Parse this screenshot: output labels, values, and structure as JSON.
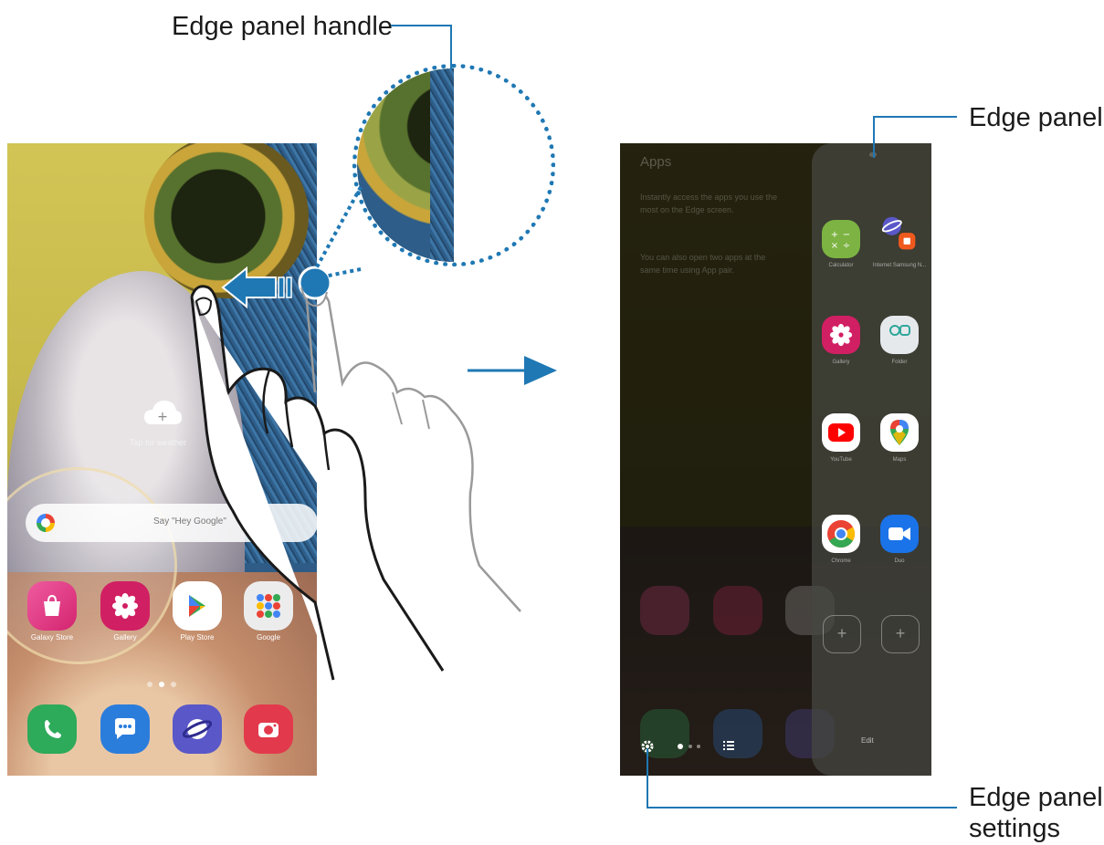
{
  "callouts": {
    "edge_panel_handle": "Edge panel handle",
    "edge_panel": "Edge panel",
    "edge_panel_settings_line1": "Edge panel",
    "edge_panel_settings_line2": "settings"
  },
  "left_phone": {
    "weather_text": "Tap for weather",
    "search_placeholder": "Say \"Hey Google\"",
    "apps_row": [
      {
        "label": "Galaxy Store",
        "icon": "shopping-bag-icon",
        "color": "#e0347f"
      },
      {
        "label": "Gallery",
        "icon": "flower-icon",
        "color": "#d11f63"
      },
      {
        "label": "Play Store",
        "icon": "play-store-icon",
        "color": "#ffffff"
      },
      {
        "label": "Google",
        "icon": "google-folder-icon",
        "color": "#f1f1f1"
      }
    ],
    "dock": [
      {
        "icon": "phone-icon",
        "color": "#2daa5a"
      },
      {
        "icon": "messages-icon",
        "color": "#2b7ddc"
      },
      {
        "icon": "internet-icon",
        "color": "#5a57c9"
      },
      {
        "icon": "camera-icon",
        "color": "#e23a4c"
      }
    ]
  },
  "right_phone": {
    "title": "Apps",
    "description_1": "Instantly access the apps you use the most on the Edge screen.",
    "description_2": "You can also open two apps at the same time using App pair.",
    "edge_apps": [
      {
        "label": "Calculator",
        "icon": "calculator-icon",
        "color": "#7cb342"
      },
      {
        "label": "Internet Samsung N...",
        "icon": "app-pair-icon",
        "color": "#5a57c9"
      },
      {
        "label": "Gallery",
        "icon": "flower-icon",
        "color": "#d11f63"
      },
      {
        "label": "Folder",
        "icon": "folder-icon",
        "color": "#e6e9ec"
      },
      {
        "label": "YouTube",
        "icon": "youtube-icon",
        "color": "#ffffff"
      },
      {
        "label": "Maps",
        "icon": "maps-icon",
        "color": "#ffffff"
      },
      {
        "label": "Chrome",
        "icon": "chrome-icon",
        "color": "#ffffff"
      },
      {
        "label": "Duo",
        "icon": "duo-icon",
        "color": "#1a73e8"
      }
    ],
    "edit_label": "Edit"
  },
  "colors": {
    "accent": "#1f78b4"
  }
}
